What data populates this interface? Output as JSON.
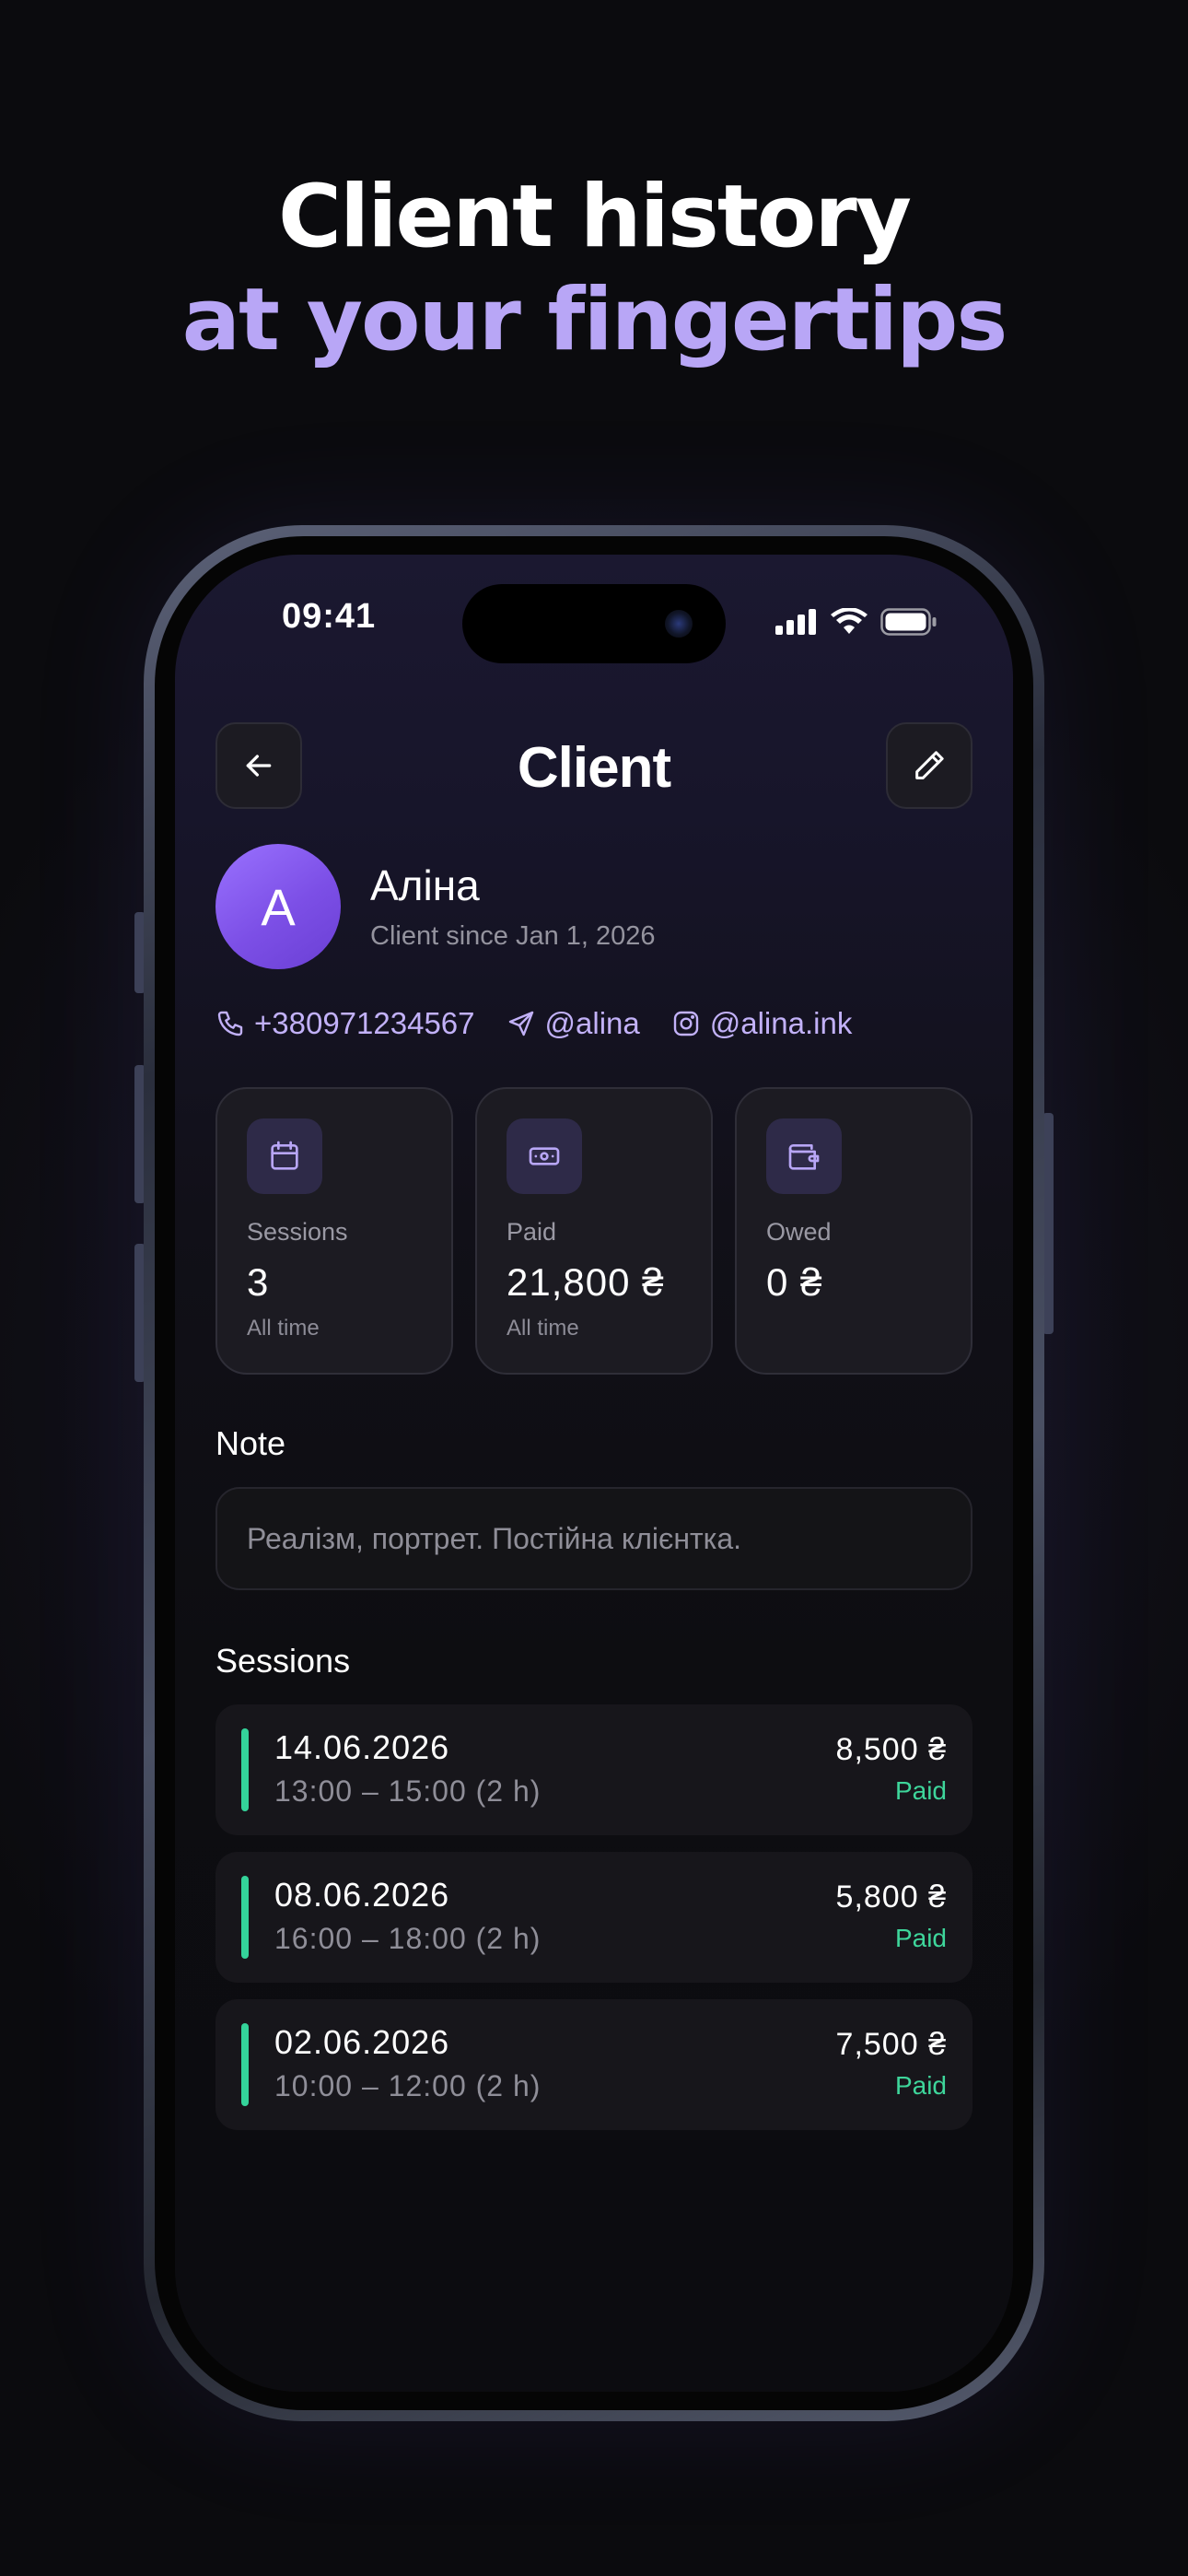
{
  "headline": {
    "part1": "Client history ",
    "accent": "at your fingertips"
  },
  "status_bar": {
    "time": "09:41"
  },
  "header": {
    "title": "Client",
    "back_icon": "arrow-left-icon",
    "edit_icon": "pencil-icon"
  },
  "client": {
    "avatar_letter": "A",
    "name": "Аліна",
    "since": "Client since Jan 1, 2026",
    "phone": "+380971234567",
    "telegram": "@alina",
    "instagram": "@alina.ink"
  },
  "stats": [
    {
      "icon": "calendar-icon",
      "label": "Sessions",
      "value": "3",
      "sub": "All time"
    },
    {
      "icon": "banknote-icon",
      "label": "Paid",
      "value": "21,800 ₴",
      "sub": "All time"
    },
    {
      "icon": "wallet-icon",
      "label": "Owed",
      "value": "0 ₴",
      "sub": ""
    }
  ],
  "note": {
    "title": "Note",
    "text": "Реалізм, портрет. Постійна клієнтка."
  },
  "sessions": {
    "title": "Sessions",
    "items": [
      {
        "date": "14.06.2026",
        "time": "13:00 – 15:00 (2 h)",
        "amount": "8,500 ₴",
        "status": "Paid"
      },
      {
        "date": "08.06.2026",
        "time": "16:00 – 18:00 (2 h)",
        "amount": "5,800 ₴",
        "status": "Paid"
      },
      {
        "date": "02.06.2026",
        "time": "10:00 – 12:00 (2 h)",
        "amount": "7,500 ₴",
        "status": "Paid"
      }
    ]
  },
  "colors": {
    "accent": "#b8a6f6",
    "paid": "#3ed69b",
    "avatar": "#7c4fe6"
  }
}
